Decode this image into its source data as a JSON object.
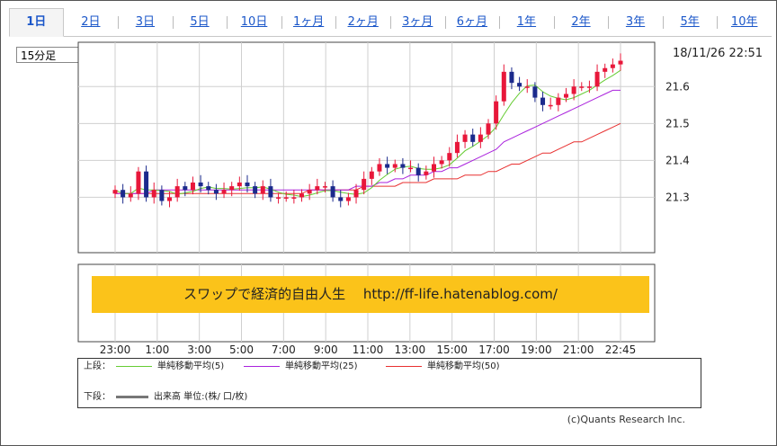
{
  "tabs": [
    "1日",
    "2日",
    "3日",
    "5日",
    "10日",
    "1ヶ月",
    "2ヶ月",
    "3ヶ月",
    "6ヶ月",
    "1年",
    "2年",
    "3年",
    "5年",
    "10年"
  ],
  "active_tab": 0,
  "interval_select": "15分足",
  "datetime": "18/11/26 22:51",
  "banner": "スワップで経済的自由人生　 http://ff-life.hatenablog.com/",
  "legend": {
    "upper_label": "上段：",
    "lower_label": "下段：",
    "ma5": "単純移動平均(5)",
    "ma25": "単純移動平均(25)",
    "ma50": "単純移動平均(50)",
    "volume": "出来高 単位:(株/ 口/枚)"
  },
  "copyright": "(c)Quants Research Inc.",
  "colors": {
    "up": "#e8173a",
    "down": "#1b2a8c",
    "ma5": "#66cc33",
    "ma25": "#aa22dd",
    "ma50": "#e83030",
    "tab": "#1a56c9"
  },
  "chart_data": {
    "type": "candlestick",
    "x_ticks": [
      "23:00",
      "1:00",
      "3:00",
      "5:00",
      "7:00",
      "9:00",
      "11:00",
      "13:00",
      "15:00",
      "17:00",
      "19:00",
      "21:00",
      "22:45"
    ],
    "y_ticks": [
      21.3,
      21.4,
      21.5,
      21.6
    ],
    "ylim": [
      21.15,
      21.72
    ],
    "grid": true,
    "closes": [
      21.32,
      21.3,
      21.31,
      21.37,
      21.3,
      21.32,
      21.29,
      21.3,
      21.33,
      21.32,
      21.34,
      21.33,
      21.32,
      21.31,
      21.32,
      21.33,
      21.34,
      21.33,
      21.31,
      21.33,
      21.3,
      21.3,
      21.3,
      21.3,
      21.31,
      21.32,
      21.33,
      21.33,
      21.3,
      21.29,
      21.3,
      21.32,
      21.35,
      21.37,
      21.39,
      21.38,
      21.39,
      21.38,
      21.38,
      21.36,
      21.37,
      21.39,
      21.4,
      21.42,
      21.45,
      21.47,
      21.45,
      21.47,
      21.5,
      21.56,
      21.64,
      21.61,
      21.6,
      21.6,
      21.57,
      21.55,
      21.55,
      21.57,
      21.58,
      21.6,
      21.6,
      21.6,
      21.64,
      21.65,
      21.66,
      21.67
    ],
    "ma25": [
      21.31,
      21.31,
      21.31,
      21.31,
      21.31,
      21.32,
      21.32,
      21.32,
      21.32,
      21.32,
      21.32,
      21.32,
      21.32,
      21.32,
      21.32,
      21.32,
      21.32,
      21.32,
      21.32,
      21.32,
      21.32,
      21.32,
      21.32,
      21.32,
      21.32,
      21.32,
      21.32,
      21.32,
      21.32,
      21.32,
      21.32,
      21.33,
      21.33,
      21.33,
      21.34,
      21.34,
      21.35,
      21.35,
      21.36,
      21.36,
      21.36,
      21.37,
      21.37,
      21.38,
      21.38,
      21.39,
      21.4,
      21.41,
      21.42,
      21.43,
      21.45,
      21.46,
      21.47,
      21.48,
      21.49,
      21.5,
      21.51,
      21.52,
      21.53,
      21.54,
      21.55,
      21.56,
      21.57,
      21.58,
      21.59,
      21.59
    ],
    "ma50": [
      21.31,
      21.31,
      21.31,
      21.31,
      21.31,
      21.31,
      21.31,
      21.31,
      21.31,
      21.31,
      21.31,
      21.31,
      21.31,
      21.31,
      21.31,
      21.31,
      21.31,
      21.31,
      21.31,
      21.31,
      21.31,
      21.31,
      21.31,
      21.31,
      21.31,
      21.32,
      21.32,
      21.32,
      21.32,
      21.32,
      21.32,
      21.32,
      21.33,
      21.33,
      21.33,
      21.33,
      21.33,
      21.34,
      21.34,
      21.34,
      21.34,
      21.35,
      21.35,
      21.35,
      21.35,
      21.36,
      21.36,
      21.36,
      21.37,
      21.37,
      21.38,
      21.39,
      21.39,
      21.4,
      21.41,
      21.42,
      21.42,
      21.43,
      21.44,
      21.45,
      21.45,
      21.46,
      21.47,
      21.48,
      21.49,
      21.5
    ]
  }
}
